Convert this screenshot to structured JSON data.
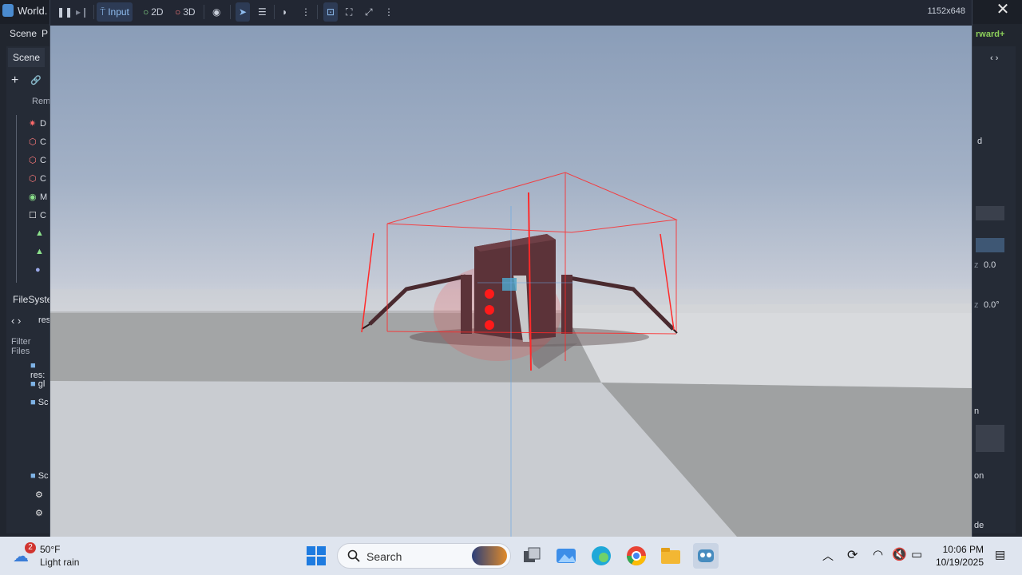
{
  "editor": {
    "title": "World.",
    "menu": [
      "Scene",
      "P"
    ],
    "renderer": "rward+",
    "left_dock": {
      "scene_tab": "Scene",
      "remote_tab": "Rem",
      "nodes": [
        "D",
        "C",
        "C",
        "C",
        "M",
        "C"
      ],
      "filesystem_tab": "FileSyster",
      "path": "res",
      "filter_placeholder": "Filter Files",
      "files": [
        "res:",
        "gl",
        "Sc",
        "Sc"
      ]
    },
    "right_dock": {
      "labels": [
        "d",
        "n",
        "on",
        "de"
      ],
      "value_1": "0.0",
      "value_2": "0.0°",
      "axis_z_1": "z",
      "axis_z_2": "z"
    }
  },
  "game": {
    "toolbar": {
      "input_label": "Input",
      "mode_2d": "2D",
      "mode_3d": "3D"
    },
    "resolution": "1152x648"
  },
  "taskbar": {
    "weather": {
      "temp": "50°F",
      "desc": "Light rain",
      "badge": "2"
    },
    "search_placeholder": "Search",
    "time": "10:06 PM",
    "date": "10/19/2025"
  },
  "colors": {
    "accent": "#8fbdf0",
    "selection_red": "#ff2a2a",
    "robot_body": "#5c3339"
  }
}
